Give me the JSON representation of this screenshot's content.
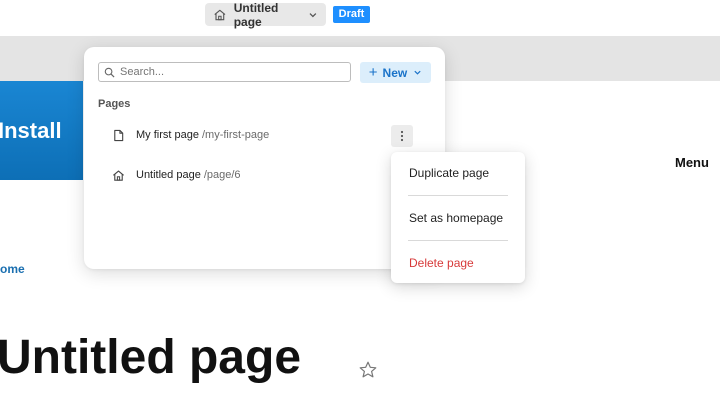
{
  "topbar": {
    "page_name": "Untitled page",
    "status_badge": "Draft",
    "icons": {
      "home": "home-icon",
      "dropdown": "chevron-down-icon"
    }
  },
  "site": {
    "install_label": "Install",
    "menu_label": "Menu",
    "home_link": "ome",
    "page_heading": "Untitled page",
    "install_color": "#1a86d3"
  },
  "pages_panel": {
    "search_placeholder": "Search...",
    "new_label": "New",
    "section_label": "Pages",
    "pages": [
      {
        "name": "My first page",
        "path": "/my-first-page",
        "icon": "file-icon"
      },
      {
        "name": "Untitled page",
        "path": "/page/6",
        "icon": "home-icon"
      }
    ]
  },
  "context_menu": {
    "items": [
      {
        "label": "Duplicate page"
      },
      {
        "label": "Set as homepage"
      },
      {
        "label": "Delete page",
        "color": "#d73a3a"
      }
    ]
  },
  "colors": {
    "accent": "#1e8fff",
    "new_button_bg": "#dceefb",
    "danger": "#d73a3a"
  }
}
